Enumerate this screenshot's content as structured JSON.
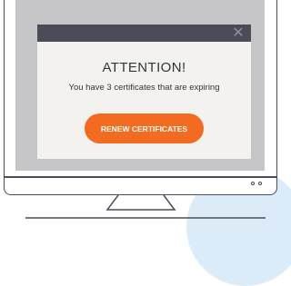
{
  "colors": {
    "accent": "#f36b21",
    "titlebar": "#4a4d57",
    "screen": "#c6c6c9",
    "dialog_bg": "#f3f2ef",
    "bubble": "#dcebf8"
  },
  "dialog": {
    "close_icon": "close-icon",
    "close_glyph": "✕",
    "title": "ATTENTION!",
    "message": "You have 3 certificates that are expiring",
    "button_label": "RENEW CERTIFICATES"
  }
}
